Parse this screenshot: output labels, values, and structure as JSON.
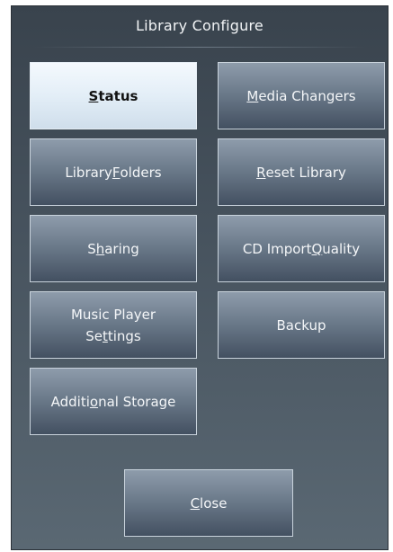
{
  "dialog": {
    "title": "Library Configure"
  },
  "buttons": {
    "status": {
      "label": "Status",
      "mnemonic": "S"
    },
    "media_changers": {
      "label": "Media Changers",
      "mnemonic": "M"
    },
    "library_folders": {
      "label": "Library Folders",
      "mnemonic": "F"
    },
    "reset_library": {
      "label": "Reset Library",
      "mnemonic": "R"
    },
    "sharing": {
      "label": "Sharing",
      "mnemonic": "h"
    },
    "cd_import_quality": {
      "label": "CD Import Quality",
      "mnemonic": "Q"
    },
    "music_player_settings": {
      "label_line1": "Music Player",
      "label_line2": "Settings",
      "mnemonic": "t"
    },
    "backup": {
      "label": "Backup",
      "mnemonic": ""
    },
    "additional_storage": {
      "label": "Additional Storage",
      "mnemonic": "o"
    },
    "close": {
      "label": "Close",
      "mnemonic": "C"
    }
  },
  "state": {
    "selected_button": "status"
  },
  "colors": {
    "dialog_top": "#39434d",
    "dialog_bottom": "#5a6873",
    "button_top": "#8e9cab",
    "button_bottom": "#435061",
    "button_border": "#c9d3dc",
    "selected_top": "#f4f9fd",
    "selected_bottom": "#cfdeeb",
    "text_light": "#f4f6f8",
    "text_dark": "#111111"
  }
}
